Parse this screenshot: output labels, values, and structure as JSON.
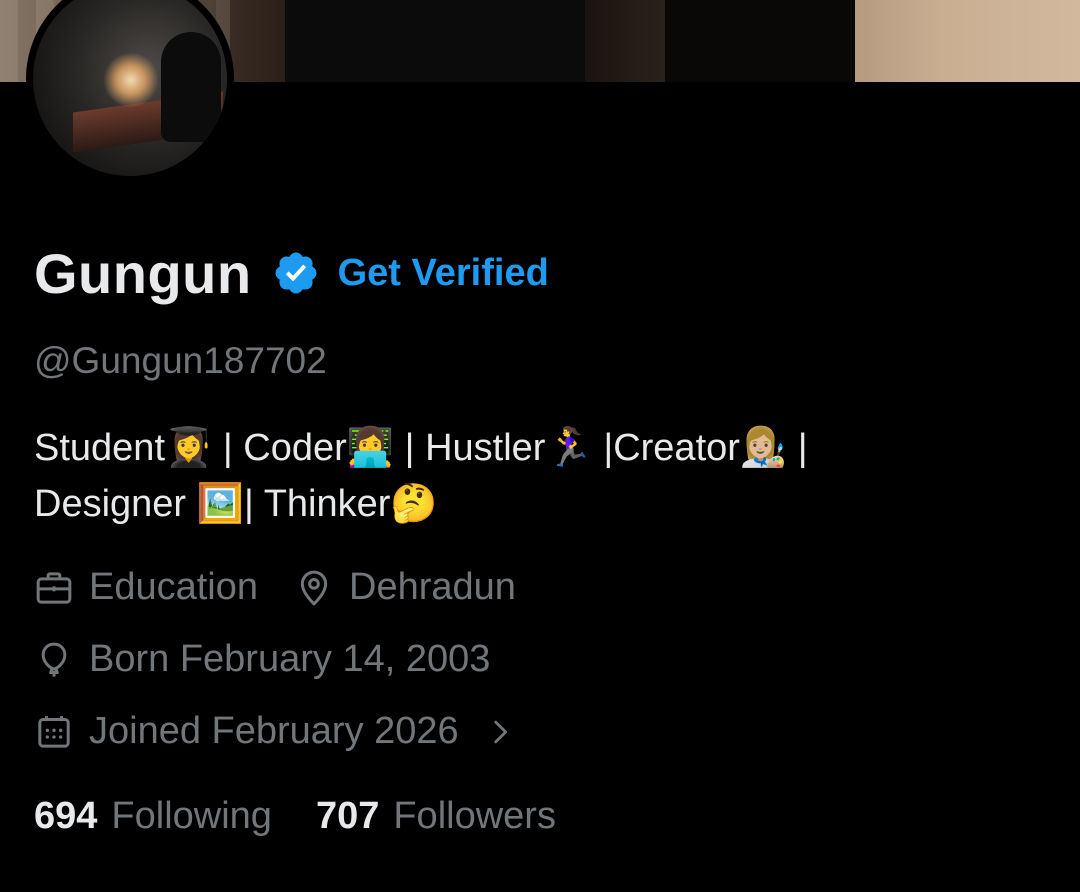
{
  "profile": {
    "display_name": "Gungun",
    "get_verified_label": "Get Verified",
    "handle": "@Gungun187702",
    "bio_line1": "Student👩‍🎓 | Coder👩‍💻 | Hustler🏃‍♀️ |Creator👩🏼‍🎨 |",
    "bio_line2": "Designer 🖼️| Thinker🤔",
    "profession": "Education",
    "location": "Dehradun",
    "birthday": "Born February 14, 2003",
    "joined": "Joined February 2026",
    "following_count": "694",
    "following_label": "Following",
    "followers_count": "707",
    "followers_label": "Followers"
  },
  "icons": {
    "verified": "verified-badge-icon",
    "profession": "briefcase-icon",
    "location": "location-pin-icon",
    "birthday": "balloon-icon",
    "joined": "calendar-icon",
    "chevron": "chevron-right-icon"
  },
  "colors": {
    "background": "#000000",
    "primary_text": "#e7e9ea",
    "secondary_text": "#71767b",
    "accent": "#1d9bf0"
  }
}
